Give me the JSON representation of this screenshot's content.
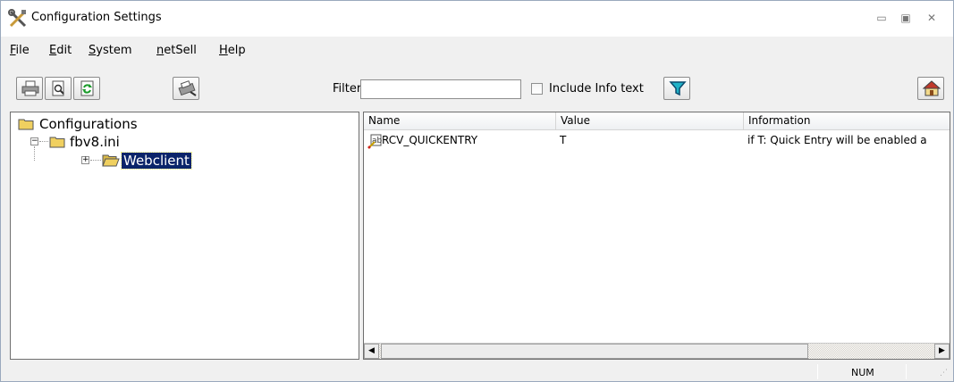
{
  "window": {
    "title": "Configuration Settings",
    "controls": [
      "minimize",
      "maximize",
      "close"
    ]
  },
  "menu": {
    "items": [
      {
        "label_u": "F",
        "label_rest": "ile"
      },
      {
        "label_u": "E",
        "label_rest": "dit"
      },
      {
        "label_u": "S",
        "label_rest": "ystem"
      },
      {
        "label_u": "n",
        "label_rest": "etSell"
      },
      {
        "label_u": "H",
        "label_rest": "elp"
      }
    ]
  },
  "toolbar": {
    "filter_label": "Filter",
    "filter_value": "",
    "include_info_label": "Include Info text",
    "include_info_checked": false,
    "icons": [
      "print-icon",
      "print-preview-icon",
      "refresh-icon",
      "printer-settings-icon",
      "filter-icon",
      "home-icon"
    ]
  },
  "tree": {
    "root": "Configurations",
    "child": "fbv8.ini",
    "grandchild": "Webclient",
    "selected": "Webclient"
  },
  "list": {
    "columns": [
      "Name",
      "Value",
      "Information"
    ],
    "rows": [
      {
        "name": "RCV_QUICKENTRY",
        "value": "T",
        "info": "if T: Quick Entry will be enabled a"
      }
    ]
  },
  "status": {
    "num": "NUM"
  }
}
